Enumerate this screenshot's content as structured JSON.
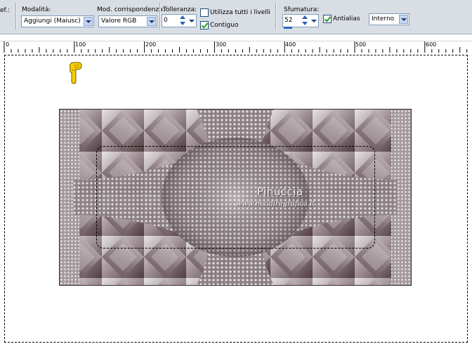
{
  "toolbar": {
    "cut_label": "ef.:",
    "modalita": {
      "label": "Modalità:",
      "value": "Aggiungi (Maiusc)"
    },
    "corrispondenza": {
      "label": "Mod. corrispondenza:",
      "value": "Valore RGB"
    },
    "tolleranza": {
      "label": "Tolleranza:",
      "value": "0"
    },
    "utilizza_livelli": {
      "label": "Utilizza tutti i livelli",
      "checked": false
    },
    "contiguo": {
      "label": "Contiguo",
      "checked": true
    },
    "sfumatura": {
      "label": "Sfumatura:",
      "value": "52",
      "progress": 0.26
    },
    "antialias": {
      "label": "Antialias",
      "checked": true
    },
    "interno": {
      "value": "Interno"
    }
  },
  "ruler": {
    "labels": [
      "0",
      "100",
      "200",
      "300",
      "400",
      "500",
      "600"
    ]
  },
  "canvas": {
    "watermark_title": "Pinuccia",
    "watermark_url": "www.maidiregrafica.it",
    "image_colors": {
      "dark": "#4e3b3f",
      "mid": "#9c8d91",
      "light": "#e6e2e4"
    },
    "pointer_icon": "pointing-hand-icon"
  }
}
